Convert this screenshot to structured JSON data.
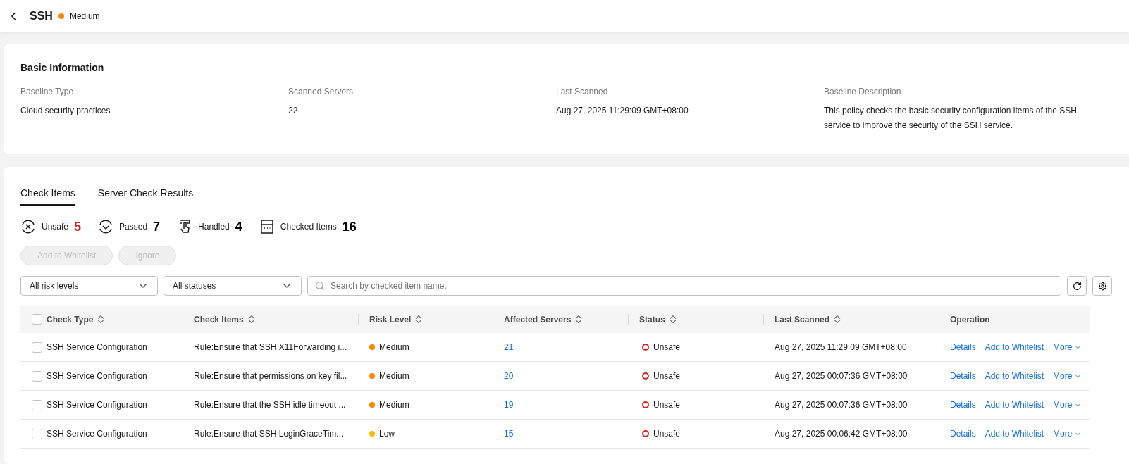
{
  "header": {
    "title": "SSH",
    "risk": {
      "label": "Medium",
      "color": "#ff8800"
    }
  },
  "basic_info": {
    "title": "Basic Information",
    "fields": [
      {
        "label": "Baseline Type",
        "value": "Cloud security practices"
      },
      {
        "label": "Scanned Servers",
        "value": "22"
      },
      {
        "label": "Last Scanned",
        "value": "Aug 27, 2025 11:29:09 GMT+08:00"
      },
      {
        "label": "Baseline Description",
        "value": "This policy checks the basic security configuration items of the SSH service to improve the security of the SSH service."
      }
    ]
  },
  "tabs": [
    {
      "label": "Check Items",
      "selected": true
    },
    {
      "label": "Server Check Results",
      "selected": false
    }
  ],
  "stats": [
    {
      "kind": "unsafe",
      "label": "Unsafe",
      "value": "5",
      "color": "#e02020"
    },
    {
      "kind": "passed",
      "label": "Passed",
      "value": "7",
      "color": "#000000"
    },
    {
      "kind": "handled",
      "label": "Handled",
      "value": "4",
      "color": "#000000"
    },
    {
      "kind": "checked",
      "label": "Checked Items",
      "value": "16",
      "color": "#000000"
    }
  ],
  "actions": [
    {
      "label": "Add to Whitelist",
      "disabled": true
    },
    {
      "label": "Ignore",
      "disabled": true
    }
  ],
  "filters": [
    {
      "value": "All risk levels"
    },
    {
      "value": "All statuses"
    }
  ],
  "search": {
    "placeholder": "Search by checked item name."
  },
  "table": {
    "all_checked": false,
    "columns": [
      {
        "label": "Check Type",
        "sortable": true
      },
      {
        "label": "Check Items",
        "sortable": true
      },
      {
        "label": "Risk Level",
        "sortable": true
      },
      {
        "label": "Affected Servers",
        "sortable": true
      },
      {
        "label": "Status",
        "sortable": true
      },
      {
        "label": "Last Scanned",
        "sortable": true
      },
      {
        "label": "Operation",
        "sortable": false
      }
    ],
    "rows": [
      {
        "checked": false,
        "check_type": "SSH Service Configuration",
        "check_item": "Rule:Ensure that SSH X11Forwarding i...",
        "risk": {
          "label": "Medium",
          "color": "#ff8800"
        },
        "affected": "21",
        "status": {
          "label": "Unsafe",
          "color": "#e02020"
        },
        "last_scanned": "Aug 27, 2025 11:29:09 GMT+08:00",
        "operations": [
          "Details",
          "Add to Whitelist",
          "More"
        ]
      },
      {
        "checked": false,
        "check_type": "SSH Service Configuration",
        "check_item": "Rule:Ensure that permissions on key fil...",
        "risk": {
          "label": "Medium",
          "color": "#ff8800"
        },
        "affected": "20",
        "status": {
          "label": "Unsafe",
          "color": "#e02020"
        },
        "last_scanned": "Aug 27, 2025 00:07:36 GMT+08:00",
        "operations": [
          "Details",
          "Add to Whitelist",
          "More"
        ]
      },
      {
        "checked": false,
        "check_type": "SSH Service Configuration",
        "check_item": "Rule:Ensure that the SSH idle timeout ...",
        "risk": {
          "label": "Medium",
          "color": "#ff8800"
        },
        "affected": "19",
        "status": {
          "label": "Unsafe",
          "color": "#e02020"
        },
        "last_scanned": "Aug 27, 2025 00:07:36 GMT+08:00",
        "operations": [
          "Details",
          "Add to Whitelist",
          "More"
        ]
      },
      {
        "checked": false,
        "check_type": "SSH Service Configuration",
        "check_item": "Rule:Ensure that SSH LoginGraceTim...",
        "risk": {
          "label": "Low",
          "color": "#ffbb00"
        },
        "affected": "15",
        "status": {
          "label": "Unsafe",
          "color": "#e02020"
        },
        "last_scanned": "Aug 27, 2025 00:06:42 GMT+08:00",
        "operations": [
          "Details",
          "Add to Whitelist",
          "More"
        ]
      }
    ]
  }
}
